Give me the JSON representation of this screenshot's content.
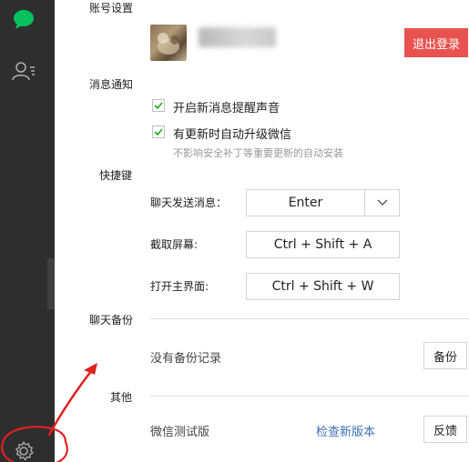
{
  "account": {
    "section_label": "账号设置",
    "logout_label": "退出登录"
  },
  "notifications": {
    "section_label": "消息通知",
    "sound_label": "开启新消息提醒声音",
    "auto_update_label": "有更新时自动升级微信",
    "auto_update_hint": "不影响安全补丁等重要更新的自动安装"
  },
  "shortcuts": {
    "section_label": "快捷键",
    "send_label": "聊天发送消息：",
    "send_value": "Enter",
    "capture_label": "截取屏幕:",
    "capture_value": "Ctrl + Shift + A",
    "main_label": "打开主界面:",
    "main_value": "Ctrl + Shift + W"
  },
  "backup": {
    "section_label": "聊天备份",
    "status": "没有备份记录",
    "button_label": "备份"
  },
  "other": {
    "section_label": "其他",
    "beta_label": "微信测试版",
    "check_update_link": "检查新版本",
    "feedback_label": "反馈"
  },
  "colors": {
    "sidebar_bg": "#2e2e2e",
    "chat_icon": "#07c160",
    "logout_bg": "#e9534f",
    "check_mark": "#1aad19",
    "link": "#3b6fb6",
    "annotation": "#e02020"
  },
  "icons": {
    "sidebar_chat": "chat-bubble-icon",
    "sidebar_contacts": "contacts-icon",
    "sidebar_settings": "gear-icon"
  }
}
